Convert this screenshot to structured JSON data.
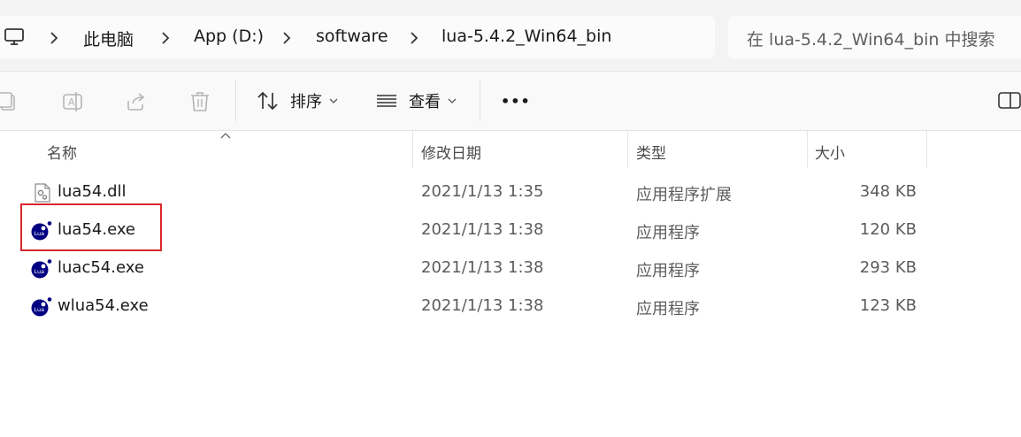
{
  "address": {
    "crumbs": [
      "此电脑",
      "App (D:)",
      "software",
      "lua-5.4.2_Win64_bin"
    ],
    "icon": "computer-icon"
  },
  "search": {
    "placeholder": "在 lua-5.4.2_Win64_bin 中搜索"
  },
  "toolbar": {
    "copy_icon": "copy-icon",
    "rename_icon": "rename-icon",
    "share_icon": "share-icon",
    "delete_icon": "delete-icon",
    "sort_label": "排序",
    "view_label": "查看",
    "more_label": "•••",
    "details_pane_icon": "details-pane-icon"
  },
  "columns": {
    "name": "名称",
    "date": "修改日期",
    "type": "类型",
    "size": "大小"
  },
  "files": [
    {
      "name": "lua54.dll",
      "date": "2021/1/13 1:35",
      "type": "应用程序扩展",
      "size": "348 KB",
      "icon": "dll-file-icon"
    },
    {
      "name": "lua54.exe",
      "date": "2021/1/13 1:38",
      "type": "应用程序",
      "size": "120 KB",
      "icon": "lua-app-icon"
    },
    {
      "name": "luac54.exe",
      "date": "2021/1/13 1:38",
      "type": "应用程序",
      "size": "293 KB",
      "icon": "lua-app-icon"
    },
    {
      "name": "wlua54.exe",
      "date": "2021/1/13 1:38",
      "type": "应用程序",
      "size": "123 KB",
      "icon": "lua-app-icon"
    }
  ],
  "colors": {
    "highlight": "#d9272e",
    "lua_blue": "#000080"
  }
}
